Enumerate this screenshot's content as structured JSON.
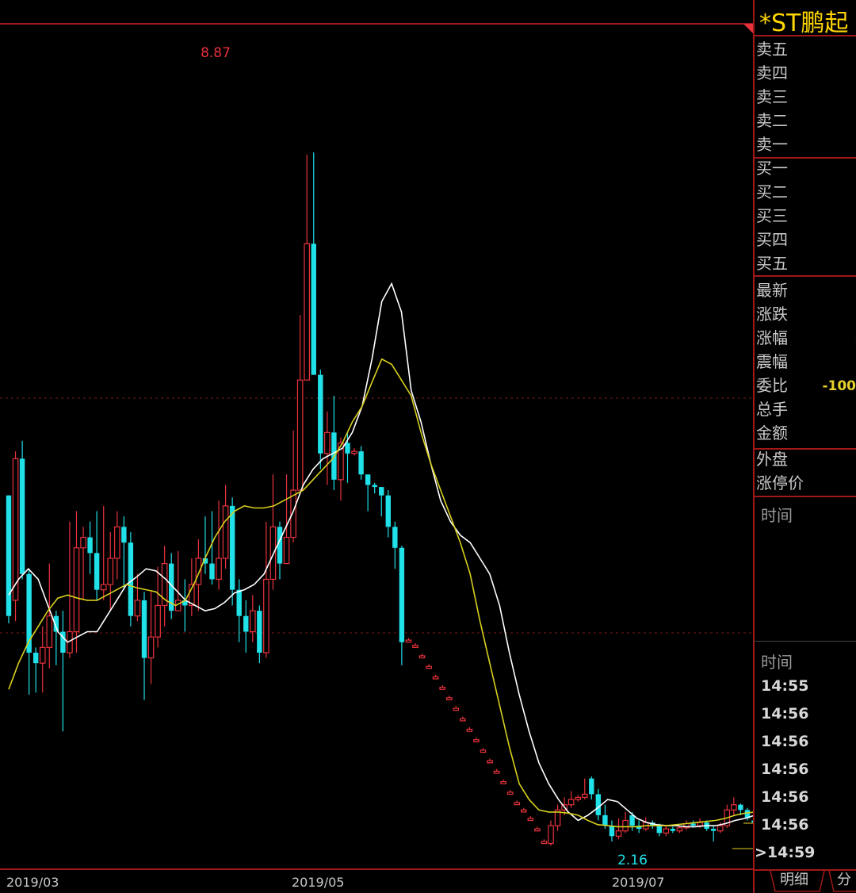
{
  "panel": {
    "stock_name": "*ST鹏起",
    "sell_labels": [
      "卖五",
      "卖四",
      "卖三",
      "卖二",
      "卖一"
    ],
    "buy_labels": [
      "买一",
      "买二",
      "买三",
      "买四",
      "买五"
    ],
    "stat_labels": [
      "最新",
      "涨跌",
      "涨幅",
      "震幅",
      "委比",
      "总手",
      "金额"
    ],
    "extra_labels": [
      "外盘",
      "涨停价"
    ],
    "partial_values": {
      "zhangfu": "-",
      "weibi": "-100"
    },
    "ticks_title": "时间",
    "trades_title": "时间",
    "trade_times": [
      "14:55",
      "14:56",
      "14:56",
      "14:56",
      "14:56",
      "14:56",
      "14:59"
    ],
    "last_time_marker": ">",
    "tabs": [
      "明细",
      "分"
    ]
  },
  "colors": {
    "up": "#e8323c",
    "down": "#20e0e8",
    "ma_short": "#ffffff",
    "ma_long": "#d8d01e",
    "border": "#a01818",
    "grid": "#7a1a1a"
  },
  "chart_data": {
    "type": "candlestick",
    "x_tick_labels": [
      "2019/03",
      "2019/05",
      "2019/07"
    ],
    "annotations": [
      {
        "text": "8.87",
        "type": "max"
      },
      {
        "text": "2.16",
        "type": "min"
      }
    ],
    "ylim": [
      2.05,
      9.75
    ],
    "candles": [
      [
        5.6,
        4.45,
        5.6,
        4.38
      ],
      [
        4.6,
        5.95,
        6.02,
        4.4
      ],
      [
        5.95,
        4.85,
        6.12,
        4.8
      ],
      [
        4.85,
        4.1,
        4.9,
        3.7
      ],
      [
        4.1,
        4.0,
        4.15,
        3.72
      ],
      [
        4.0,
        4.15,
        4.35,
        3.72
      ],
      [
        4.15,
        4.45,
        4.95,
        3.95
      ],
      [
        4.45,
        4.3,
        4.5,
        3.98
      ],
      [
        4.3,
        4.1,
        4.5,
        3.35
      ],
      [
        4.1,
        4.3,
        5.35,
        4.05
      ],
      [
        4.3,
        5.1,
        5.45,
        4.1
      ],
      [
        5.1,
        5.2,
        5.3,
        4.6
      ],
      [
        5.2,
        5.05,
        5.35,
        4.85
      ],
      [
        5.05,
        4.7,
        5.45,
        4.6
      ],
      [
        4.7,
        4.75,
        5.5,
        4.6
      ],
      [
        4.75,
        5.0,
        5.25,
        4.5
      ],
      [
        5.0,
        5.3,
        5.45,
        4.8
      ],
      [
        5.3,
        5.15,
        5.4,
        4.7
      ],
      [
        5.15,
        4.45,
        5.25,
        4.35
      ],
      [
        4.45,
        4.6,
        4.85,
        4.4
      ],
      [
        4.6,
        4.05,
        4.68,
        3.65
      ],
      [
        4.05,
        4.25,
        4.68,
        3.8
      ],
      [
        4.25,
        4.55,
        4.92,
        4.15
      ],
      [
        4.55,
        4.95,
        5.12,
        4.35
      ],
      [
        4.95,
        4.5,
        5.05,
        4.42
      ],
      [
        4.5,
        4.6,
        5.07,
        4.52
      ],
      [
        4.6,
        4.55,
        4.8,
        4.3
      ],
      [
        4.55,
        4.75,
        5.0,
        4.45
      ],
      [
        4.75,
        5.0,
        5.18,
        4.5
      ],
      [
        5.0,
        4.95,
        5.4,
        4.85
      ],
      [
        4.95,
        4.8,
        5.45,
        4.75
      ],
      [
        4.8,
        5.0,
        5.55,
        4.7
      ],
      [
        5.0,
        5.5,
        5.7,
        4.9
      ],
      [
        5.5,
        4.7,
        5.58,
        4.55
      ],
      [
        4.7,
        4.45,
        4.8,
        4.2
      ],
      [
        4.45,
        4.3,
        4.6,
        4.1
      ],
      [
        4.3,
        4.5,
        4.65,
        4.2
      ],
      [
        4.5,
        4.1,
        4.55,
        4.0
      ],
      [
        4.1,
        4.8,
        5.35,
        4.05
      ],
      [
        4.8,
        5.3,
        5.8,
        4.7
      ],
      [
        5.3,
        4.95,
        5.35,
        4.8
      ],
      [
        4.95,
        5.2,
        5.8,
        5.1
      ],
      [
        5.2,
        5.65,
        6.22,
        5.15
      ],
      [
        5.65,
        6.7,
        7.32,
        6.08
      ],
      [
        6.7,
        8.0,
        8.85,
        6.7
      ],
      [
        8.0,
        6.75,
        8.87,
        6.75
      ],
      [
        6.75,
        6.0,
        6.8,
        5.85
      ],
      [
        6.0,
        6.2,
        6.4,
        5.7
      ],
      [
        6.2,
        5.75,
        6.55,
        5.65
      ],
      [
        5.75,
        6.1,
        6.15,
        5.55
      ],
      [
        6.1,
        6.0,
        6.2,
        5.72
      ],
      [
        6.0,
        6.02,
        6.05,
        5.98
      ],
      [
        6.02,
        5.8,
        6.07,
        5.75
      ],
      [
        5.8,
        5.7,
        5.75,
        5.45
      ],
      [
        5.7,
        5.68,
        5.72,
        5.62
      ],
      [
        5.68,
        5.6,
        5.65,
        5.4
      ],
      [
        5.6,
        5.3,
        5.65,
        5.2
      ],
      [
        5.3,
        5.1,
        5.35,
        4.9
      ],
      [
        5.1,
        4.2,
        5.12,
        3.98
      ],
      [
        4.2,
        4.22,
        4.24,
        4.2
      ],
      [
        4.15,
        4.17,
        4.19,
        4.15
      ],
      [
        4.05,
        4.07,
        4.09,
        4.05
      ],
      [
        3.95,
        3.97,
        3.99,
        3.95
      ],
      [
        3.85,
        3.87,
        3.89,
        3.85
      ],
      [
        3.75,
        3.77,
        3.79,
        3.75
      ],
      [
        3.65,
        3.67,
        3.69,
        3.65
      ],
      [
        3.55,
        3.57,
        3.59,
        3.55
      ],
      [
        3.45,
        3.47,
        3.49,
        3.45
      ],
      [
        3.35,
        3.37,
        3.39,
        3.35
      ],
      [
        3.25,
        3.27,
        3.29,
        3.25
      ],
      [
        3.15,
        3.17,
        3.19,
        3.15
      ],
      [
        3.05,
        3.07,
        3.09,
        3.05
      ],
      [
        2.95,
        2.97,
        2.99,
        2.95
      ],
      [
        2.85,
        2.87,
        2.89,
        2.85
      ],
      [
        2.75,
        2.77,
        2.79,
        2.75
      ],
      [
        2.65,
        2.67,
        2.69,
        2.65
      ],
      [
        2.58,
        2.6,
        2.62,
        2.58
      ],
      [
        2.5,
        2.52,
        2.54,
        2.5
      ],
      [
        2.4,
        2.42,
        2.44,
        2.4
      ],
      [
        2.28,
        2.3,
        2.32,
        2.28
      ],
      [
        2.28,
        2.45,
        2.5,
        2.26
      ],
      [
        2.45,
        2.6,
        2.65,
        2.4
      ],
      [
        2.6,
        2.65,
        2.72,
        2.55
      ],
      [
        2.65,
        2.7,
        2.78,
        2.62
      ],
      [
        2.7,
        2.72,
        2.74,
        2.68
      ],
      [
        2.72,
        2.75,
        2.9,
        2.7
      ],
      [
        2.9,
        2.75,
        2.92,
        2.7
      ],
      [
        2.75,
        2.55,
        2.8,
        2.5
      ],
      [
        2.55,
        2.45,
        2.65,
        2.42
      ],
      [
        2.45,
        2.35,
        2.5,
        2.3
      ],
      [
        2.35,
        2.4,
        2.52,
        2.32
      ],
      [
        2.4,
        2.5,
        2.58,
        2.38
      ],
      [
        2.55,
        2.45,
        2.58,
        2.4
      ],
      [
        2.45,
        2.42,
        2.5,
        2.38
      ],
      [
        2.42,
        2.48,
        2.53,
        2.4
      ],
      [
        2.48,
        2.45,
        2.5,
        2.42
      ],
      [
        2.45,
        2.38,
        2.47,
        2.35
      ],
      [
        2.38,
        2.42,
        2.45,
        2.35
      ],
      [
        2.42,
        2.4,
        2.44,
        2.38
      ],
      [
        2.4,
        2.43,
        2.45,
        2.38
      ],
      [
        2.43,
        2.47,
        2.5,
        2.41
      ],
      [
        2.47,
        2.45,
        2.5,
        2.43
      ],
      [
        2.45,
        2.48,
        2.52,
        2.43
      ],
      [
        2.48,
        2.42,
        2.5,
        2.4
      ],
      [
        2.42,
        2.4,
        2.45,
        2.3
      ],
      [
        2.4,
        2.45,
        2.48,
        2.38
      ],
      [
        2.45,
        2.6,
        2.65,
        2.43
      ],
      [
        2.6,
        2.65,
        2.72,
        2.55
      ],
      [
        2.65,
        2.6,
        2.66,
        2.55
      ],
      [
        2.6,
        2.52,
        2.62,
        2.5
      ],
      [
        2.5,
        2.48,
        2.5,
        2.46
      ],
      [
        2.4,
        2.38,
        2.4,
        2.36
      ],
      [
        2.28,
        2.26,
        2.28,
        2.24
      ],
      [
        2.18,
        2.16,
        2.18,
        2.16
      ]
    ],
    "ma_short": [
      4.65,
      4.8,
      4.9,
      4.8,
      4.55,
      4.3,
      4.2,
      4.25,
      4.3,
      4.3,
      4.45,
      4.6,
      4.75,
      4.82,
      4.9,
      4.88,
      4.8,
      4.7,
      4.6,
      4.55,
      4.5,
      4.52,
      4.58,
      4.67,
      4.7,
      4.75,
      4.85,
      5.05,
      5.25,
      5.45,
      5.7,
      5.85,
      5.95,
      6.0,
      6.05,
      6.2,
      6.45,
      6.9,
      7.45,
      7.62,
      7.35,
      6.6,
      6.3,
      5.9,
      5.55,
      5.35,
      5.22,
      5.15,
      5.0,
      4.85,
      4.55,
      4.1,
      3.7,
      3.35,
      3.05,
      2.85,
      2.7,
      2.58,
      2.5,
      2.55,
      2.62,
      2.7,
      2.68,
      2.6,
      2.52,
      2.48,
      2.46,
      2.45,
      2.45,
      2.44,
      2.44,
      2.45,
      2.45,
      2.47,
      2.5,
      2.52,
      2.55,
      2.53,
      2.52
    ],
    "ma_long": [
      3.75,
      4.0,
      4.2,
      4.35,
      4.5,
      4.62,
      4.65,
      4.62,
      4.6,
      4.6,
      4.65,
      4.7,
      4.75,
      4.72,
      4.7,
      4.68,
      4.6,
      4.55,
      4.6,
      4.78,
      5.0,
      5.2,
      5.35,
      5.45,
      5.5,
      5.48,
      5.48,
      5.5,
      5.55,
      5.6,
      5.65,
      5.75,
      5.85,
      5.95,
      6.1,
      6.3,
      6.45,
      6.68,
      6.9,
      6.85,
      6.7,
      6.55,
      6.2,
      5.9,
      5.65,
      5.4,
      5.15,
      4.85,
      4.4,
      4.0,
      3.6,
      3.2,
      2.85,
      2.7,
      2.6,
      2.58,
      2.58,
      2.57,
      2.55,
      2.5,
      2.46,
      2.45,
      2.44,
      2.44,
      2.44,
      2.45,
      2.45,
      2.45,
      2.46,
      2.47,
      2.48,
      2.49,
      2.5,
      2.52,
      2.55,
      2.57,
      2.58,
      2.56,
      2.52
    ]
  }
}
